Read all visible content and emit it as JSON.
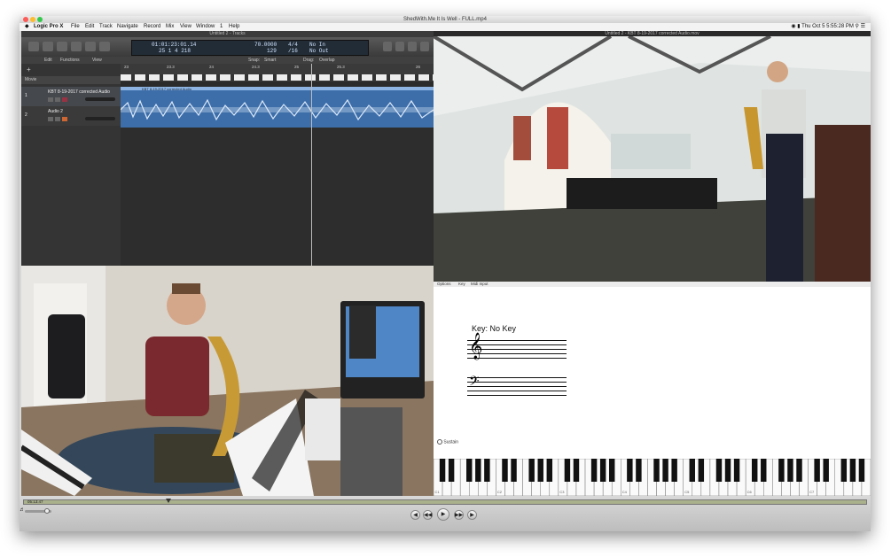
{
  "window": {
    "title": "ShedWith.Me It Is Well - FULL.mp4"
  },
  "menubar": {
    "apple": "",
    "app": "Logic Pro X",
    "items": [
      "File",
      "Edit",
      "Track",
      "Navigate",
      "Record",
      "Mix",
      "View",
      "Window",
      "1",
      "Help"
    ],
    "clock": "Thu Oct 5  5:55:28 PM"
  },
  "logic": {
    "window_title": "Untitled 2 - Tracks",
    "lcd": {
      "time_top": "01:01:23:01.14",
      "time_bottom": "25  1  4  218",
      "tempo": "70.0000",
      "tempo_sub": "129",
      "signature": "4/4",
      "division": "/16",
      "in": "No In",
      "out": "No Out"
    },
    "toolbar": {
      "edit": "Edit",
      "functions": "Functions",
      "view": "View",
      "snap_label": "Snap:",
      "snap_value": "Smart",
      "drag_label": "Drag:",
      "drag_value": "Overlap"
    },
    "ruler": [
      "23",
      "23.3",
      "24",
      "24.3",
      "25",
      "25.3",
      "26"
    ],
    "movie_label": "Movie",
    "tracks": [
      {
        "num": "1",
        "name": "KBT 8-19-2017 corrected Audio"
      },
      {
        "num": "2",
        "name": "Audio 2"
      }
    ],
    "region_label": "KBT 8-19-2017 corrected Audio"
  },
  "video_top": {
    "title": "Untitled 2 - KBT 8-19-2017 corrected Audio.mov"
  },
  "notation": {
    "menu": [
      "Options",
      "Key",
      "Midi Input"
    ],
    "key_text": "Key: No Key",
    "sustain": "Sustain",
    "octaves": [
      "C1",
      "C2",
      "C3",
      "C4",
      "C5",
      "C6",
      "C7"
    ]
  },
  "transport": {
    "time": "05:13:47"
  }
}
